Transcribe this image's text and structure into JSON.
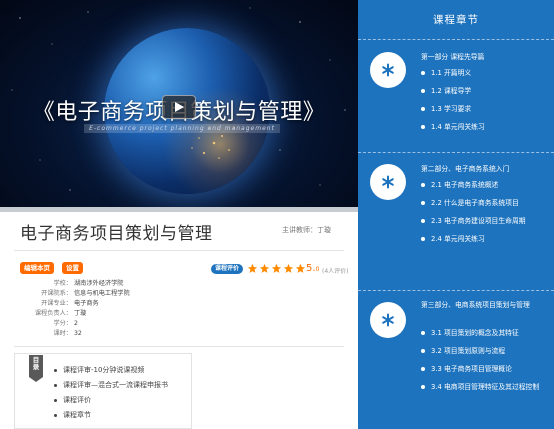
{
  "hero": {
    "title": "《电子商务项目策划与管理》",
    "subtitle": "E-commerce project planning and management"
  },
  "course": {
    "title": "电子商务项目策划与管理",
    "teacher": "主讲教师：丁璇",
    "tags": [
      "编辑本页",
      "设置"
    ],
    "rating_label": "课程评价",
    "stars": 5,
    "score_main": "5.",
    "score_decimal": "0",
    "reviews": "(4人评价)",
    "info": [
      {
        "k": "学校：",
        "v": "湖南涉外经济学院"
      },
      {
        "k": "开课院系：",
        "v": "信息与机电工程学院"
      },
      {
        "k": "开课专业：",
        "v": "电子商务"
      },
      {
        "k": "课程负责人：",
        "v": "丁璇"
      },
      {
        "k": "学分：",
        "v": "2"
      },
      {
        "k": "课时：",
        "v": "32"
      }
    ]
  },
  "toc": {
    "label_line1": "目",
    "label_line2": "录",
    "items": [
      "课程评审-10分钟说课视频",
      "课程评审—混合式一流课程申报书",
      "课程评价",
      "课程章节"
    ]
  },
  "sidebar": {
    "header": "课程章节",
    "sections": [
      {
        "title": "第一部分 课程先导篇",
        "items": [
          "1.1 开篇明义",
          "1.2 课程导学",
          "1.3 学习要求",
          "1.4 单元闯关练习"
        ]
      },
      {
        "title": "第二部分、电子商务系统入门",
        "items": [
          "2.1 电子商务系统概述",
          "2.2 什么是电子商务系统项目",
          "2.3 电子商务建设项目生命周期",
          "2.4 单元闯关练习"
        ]
      },
      {
        "title": "第三部分、电商系统项目策划与管理",
        "items": [
          "3.1 项目策划的概念及其特征",
          "3.2 项目策划原则与流程",
          "3.3 电子商务项目管理概论",
          "3.4 电商项目管理特征及其过程控制"
        ]
      }
    ]
  },
  "colors": {
    "sidebar_bg": "#1e73be",
    "tag_orange": "#ff6a00",
    "star": "#ff8a00"
  }
}
